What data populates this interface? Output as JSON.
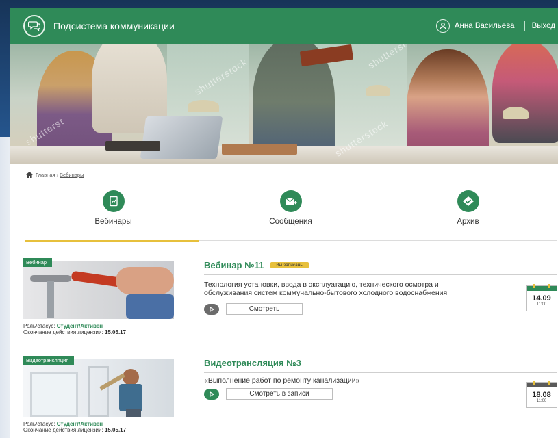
{
  "header": {
    "app_title": "Подсистема коммуникации",
    "user_name": "Анна Васильева",
    "logout_label": "Выход"
  },
  "hero": {
    "watermarks": [
      "shutterstock",
      "shutterst",
      "shutterstock",
      "shutterst"
    ]
  },
  "breadcrumb": {
    "home": "Главная",
    "separator": "›",
    "current": "Вебинары"
  },
  "tabs": [
    {
      "label": "Вебинары",
      "icon": "document-chart-icon",
      "active": true
    },
    {
      "label": "Сообщения",
      "icon": "envelope-icon",
      "active": false
    },
    {
      "label": "Архив",
      "icon": "archive-diamond-icon",
      "active": false
    }
  ],
  "items": [
    {
      "type_badge": "Вебинар",
      "title": "Вебинар №11",
      "status_badge": "Вы записаны",
      "description": "Технология установки, ввода в эксплуатацию, технического осмотра и обслуживания систем коммунально-бытового холодного водоснабжения",
      "button": "Смотреть",
      "date": "14.09",
      "time": "11:00",
      "role_label": "Роль/стасус:",
      "role_value": "Студент/Активен",
      "license_label": "Окончание действия лицензии:",
      "license_value": "15.05.17"
    },
    {
      "type_badge": "Видеотрансляция",
      "title": "Видеотрансляция №3",
      "status_badge": "",
      "description": "«Выполнение работ по ремонту канализации»",
      "button": "Смотреть в записи",
      "date": "18.08",
      "time": "11:00",
      "role_label": "Роль/стасус:",
      "role_value": "Студент/Активен",
      "license_label": "Окончание действия лицензии:",
      "license_value": "15.05.17"
    }
  ],
  "colors": {
    "brand_green": "#2f8a58",
    "accent_yellow": "#e7c03c",
    "backdrop_blue": "#1c3d68"
  }
}
